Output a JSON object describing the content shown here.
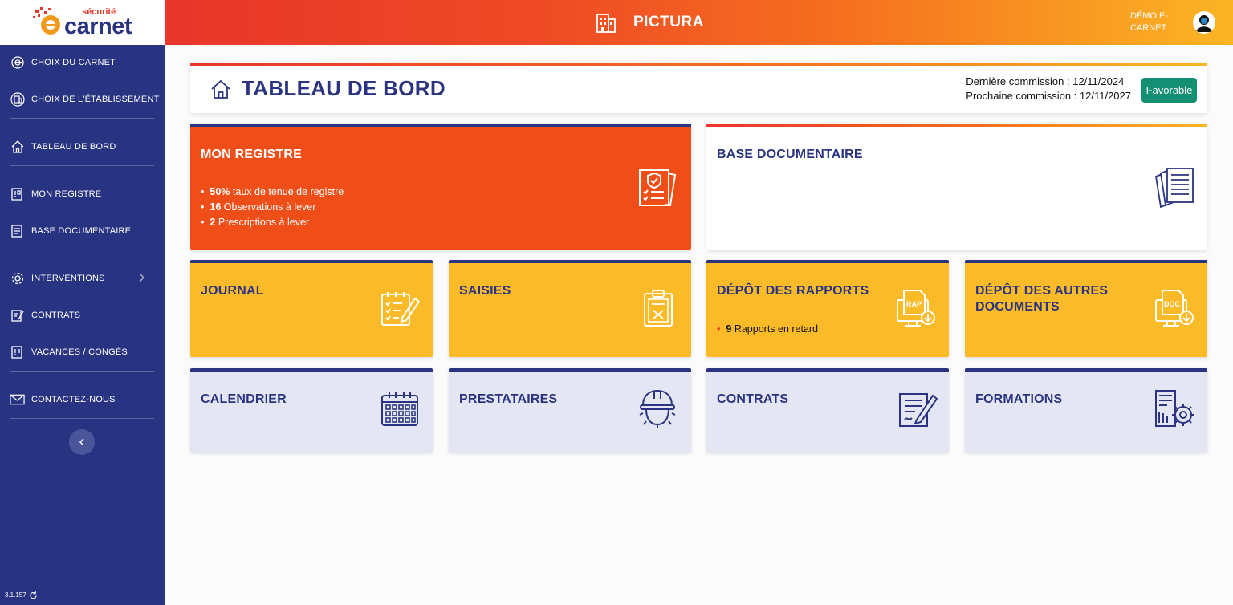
{
  "logo": {
    "small": "sécurité",
    "big": "carnet"
  },
  "header": {
    "app_title": "PICTURA",
    "user_name": "DÉMO E-CARNET"
  },
  "sidebar": {
    "items": [
      {
        "label": "CHOIX DU CARNET",
        "icon": "carnet-icon"
      },
      {
        "label": "CHOIX DE L'ÉTABLISSEMENT",
        "icon": "establishment-icon"
      },
      {
        "label": "TABLEAU DE BORD",
        "icon": "home-icon"
      },
      {
        "label": "MON REGISTRE",
        "icon": "register-icon"
      },
      {
        "label": "BASE DOCUMENTAIRE",
        "icon": "documents-icon"
      },
      {
        "label": "INTERVENTIONS",
        "icon": "gear-icon"
      },
      {
        "label": "CONTRATS",
        "icon": "contract-icon"
      },
      {
        "label": "VACANCES / CONGÉS",
        "icon": "calendar-icon"
      },
      {
        "label": "CONTACTEZ-NOUS",
        "icon": "mail-icon"
      }
    ],
    "version": "3.1.157"
  },
  "page": {
    "title": "TABLEAU DE BORD",
    "last_commission": "Dernière commission : 12/11/2024",
    "next_commission": "Prochaine commission : 12/11/2027",
    "status": "Favorable"
  },
  "cards": {
    "registre": {
      "title": "MON REGISTRE",
      "stats": [
        {
          "value": "50%",
          "text": " taux de tenue de registre"
        },
        {
          "value": "16",
          "text": " Observations à lever"
        },
        {
          "value": "2",
          "text": " Prescriptions à lever"
        }
      ]
    },
    "base_doc": {
      "title": "BASE DOCUMENTAIRE"
    },
    "journal": {
      "title": "JOURNAL"
    },
    "saisies": {
      "title": "SAISIES"
    },
    "depot_rapports": {
      "title": "DÉPÔT DES RAPPORTS",
      "late_value": "9",
      "late_text": " Rapports en retard"
    },
    "depot_autres": {
      "title": "DÉPÔT DES AUTRES DOCUMENTS"
    },
    "calendrier": {
      "title": "CALENDRIER"
    },
    "prestataires": {
      "title": "PRESTATAIRES"
    },
    "contrats": {
      "title": "CONTRATS"
    },
    "formations": {
      "title": "FORMATIONS"
    }
  },
  "colors": {
    "navy": "#283381",
    "orange": "#f04e18",
    "yellow": "#fbbb28",
    "grey": "#e4e7f3",
    "green": "#138f73"
  }
}
